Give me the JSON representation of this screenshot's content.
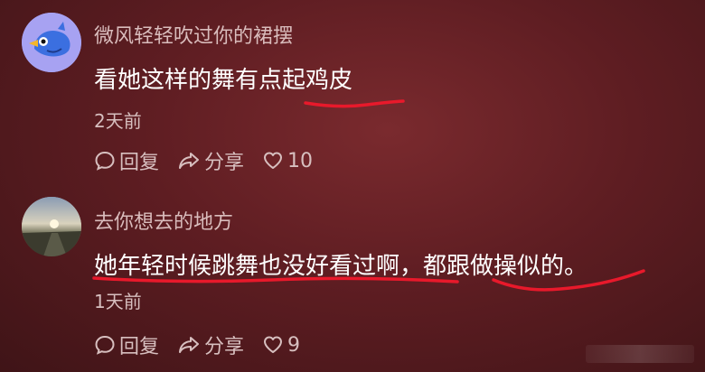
{
  "comments": [
    {
      "username": "微风轻轻吹过你的裙摆",
      "text": "看她这样的舞有点起鸡皮",
      "time": "2天前",
      "reply_label": "回复",
      "share_label": "分享",
      "likes": "10"
    },
    {
      "username": "去你想去的地方",
      "text": "她年轻时候跳舞也没好看过啊，都跟做操似的。",
      "time": "1天前",
      "reply_label": "回复",
      "share_label": "分享",
      "likes": "9"
    }
  ],
  "colors": {
    "underline": "#e8192b",
    "background": "#5e1d22"
  }
}
